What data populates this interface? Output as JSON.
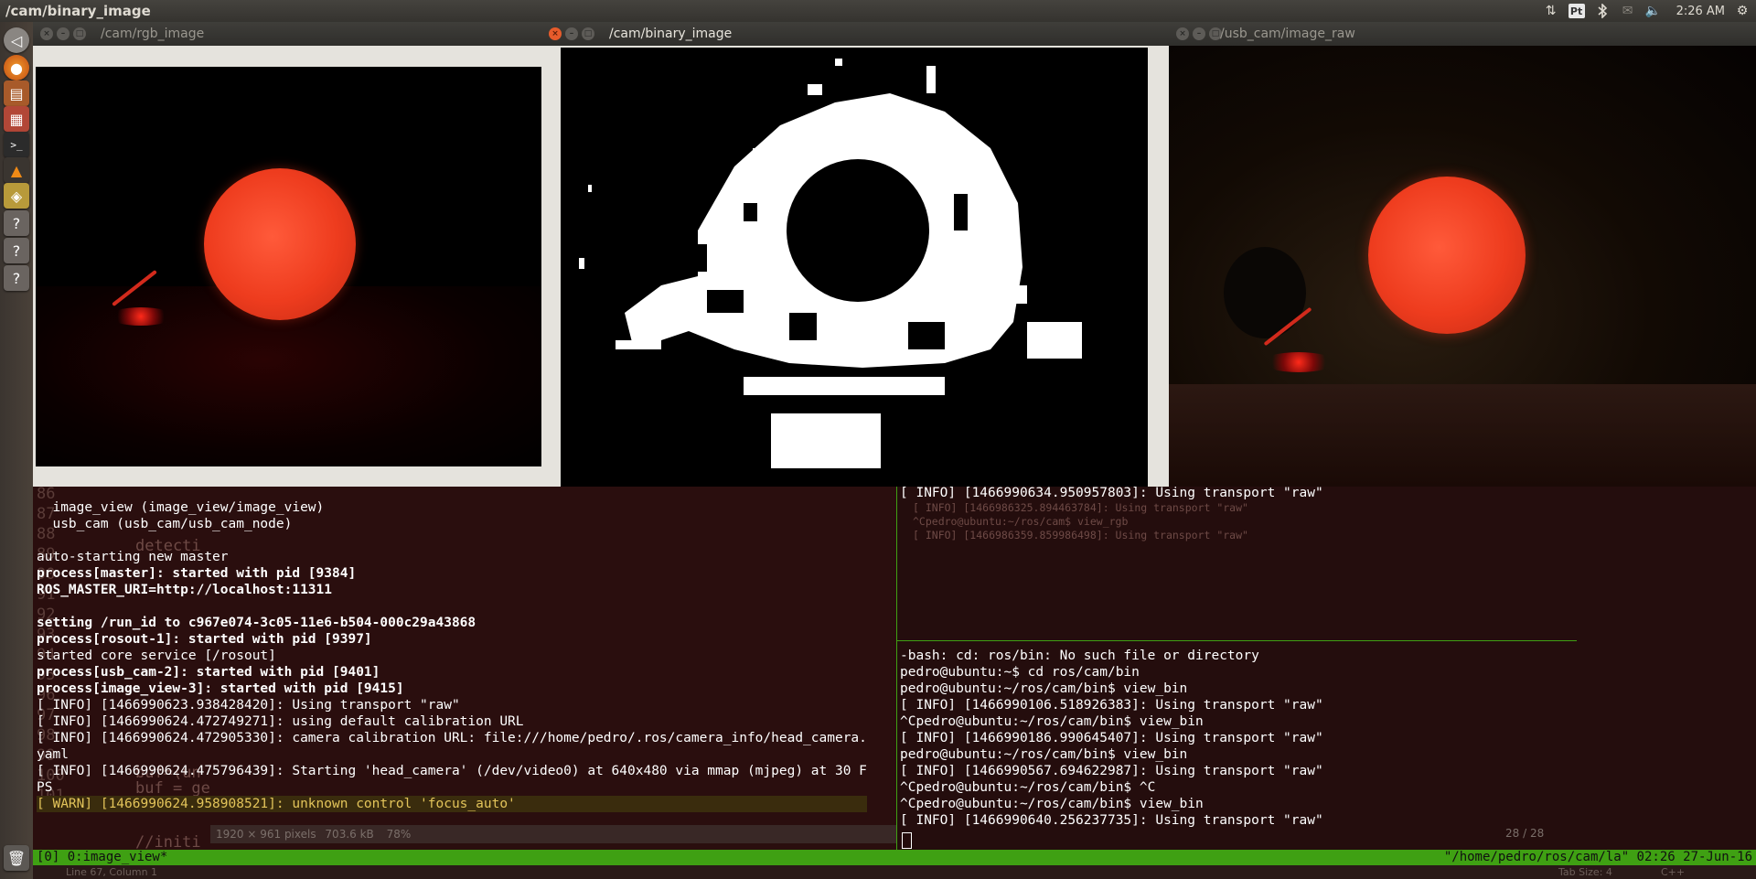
{
  "topbar": {
    "window_title": "/cam/binary_image",
    "pt_label": "Pt",
    "clock": "2:26 AM",
    "icons": [
      "network-updown-icon",
      "keyboard-layout-icon",
      "bluetooth-icon",
      "mail-icon",
      "volume-icon",
      "gear-icon"
    ]
  },
  "launcher": {
    "icons": [
      "unity-home-icon",
      "firefox-icon",
      "files-icon",
      "calculator-icon",
      "terminal-icon",
      "vlc-icon",
      "image-viewer-icon",
      "unknown-app-icon",
      "unknown-app-icon",
      "unknown-app-icon",
      "trash-icon"
    ]
  },
  "windows": {
    "rgb": {
      "title": "/cam/rgb_image"
    },
    "binary": {
      "title": "/cam/binary_image"
    },
    "raw": {
      "title": "/usb_cam/image_raw"
    }
  },
  "terminal_left": {
    "lines": [
      {
        "t": "  image_view (image_view/image_view)",
        "s": ""
      },
      {
        "t": "  usb_cam (usb_cam/usb_cam_node)",
        "s": ""
      },
      {
        "t": "",
        "s": ""
      },
      {
        "t": "auto-starting new master",
        "s": ""
      },
      {
        "t": "process[master]: started with pid [9384]",
        "s": "b"
      },
      {
        "t": "ROS_MASTER_URI=http://localhost:11311",
        "s": "b"
      },
      {
        "t": "",
        "s": ""
      },
      {
        "t": "setting /run_id to c967e074-3c05-11e6-b504-000c29a43868",
        "s": "b"
      },
      {
        "t": "process[rosout-1]: started with pid [9397]",
        "s": "b"
      },
      {
        "t": "started core service [/rosout]",
        "s": ""
      },
      {
        "t": "process[usb_cam-2]: started with pid [9401]",
        "s": "b"
      },
      {
        "t": "process[image_view-3]: started with pid [9415]",
        "s": "b"
      },
      {
        "t": "[ INFO] [1466990623.938428420]: Using transport \"raw\"",
        "s": ""
      },
      {
        "t": "[ INFO] [1466990624.472749271]: using default calibration URL",
        "s": ""
      },
      {
        "t": "[ INFO] [1466990624.472905330]: camera calibration URL: file:///home/pedro/.ros/camera_info/head_camera.",
        "s": ""
      },
      {
        "t": "yaml",
        "s": ""
      },
      {
        "t": "[ INFO] [1466990624.475796439]: Starting 'head_camera' (/dev/video0) at 640x480 via mmap (mjpeg) at 30 F",
        "s": ""
      },
      {
        "t": "PS",
        "s": ""
      },
      {
        "t": "[ WARN] [1466990624.958908521]: unknown control 'focus_auto'",
        "s": "warn"
      }
    ]
  },
  "terminal_right": {
    "top_lines": [
      "[ INFO] [1466990634.950957803]: Using transport \"raw\""
    ],
    "lines": [
      "-bash: cd: ros/bin: No such file or directory",
      "pedro@ubuntu:~$ cd ros/cam/bin",
      "pedro@ubuntu:~/ros/cam/bin$ view_bin",
      "[ INFO] [1466990106.518926383]: Using transport \"raw\"",
      "^Cpedro@ubuntu:~/ros/cam/bin$ view_bin",
      "[ INFO] [1466990186.990645407]: Using transport \"raw\"",
      "pedro@ubuntu:~/ros/cam/bin$ view_bin",
      "[ INFO] [1466990567.694622987]: Using transport \"raw\"",
      "^Cpedro@ubuntu:~/ros/cam/bin$ ^C",
      "^Cpedro@ubuntu:~/ros/cam/bin$ view_bin",
      "[ INFO] [1466990640.256237735]: Using transport \"raw\""
    ]
  },
  "statusbar": {
    "left": "[0] 0:image_view*",
    "right": "\"/home/pedro/ros/cam/la\" 02:26 27-Jun-16"
  },
  "image_info": {
    "dims": "1920 × 961 pixels",
    "size": "703.6 kB",
    "zoom": "78%",
    "page": "28 / 28"
  },
  "editor_status": {
    "position": "Line 67, Column 1",
    "tab_size": "Tab Size: 4",
    "language": "C++"
  },
  "gutter_numbers": [
    "86",
    "87",
    "88",
    "89",
    "90",
    "91",
    "92",
    "93",
    "94",
    "95",
    "96",
    "97",
    "98",
    "99",
    "100",
    "101"
  ],
  "ghost_code": {
    "detection": "detecti",
    "buf1": "buf=(un",
    "buf2": "buf = ge",
    "init": "//initi"
  }
}
